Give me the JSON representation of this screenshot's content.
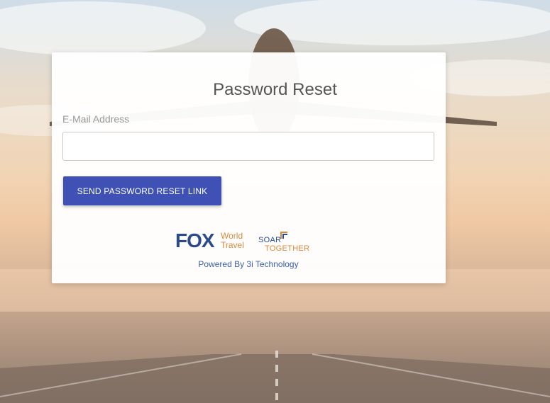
{
  "form": {
    "title": "Password Reset",
    "email_label": "E-Mail Address",
    "email_value": "",
    "email_placeholder": "",
    "submit_label": "SEND PASSWORD RESET LINK"
  },
  "footer": {
    "fox_mark": "FOX",
    "fox_word_1": "World",
    "fox_word_2": "Travel",
    "soar_word": "SOAR",
    "together_word": "TOGETHER",
    "powered_by": "Powered By 3i Technology"
  },
  "colors": {
    "accent": "#3f51b5",
    "brand_blue": "#2b4a8c",
    "brand_orange": "#d98a3c"
  },
  "icons": {
    "background": "airplane-runway-background",
    "fox_logo": "fox-world-travel-logo",
    "soar_logo": "soar-together-logo"
  }
}
